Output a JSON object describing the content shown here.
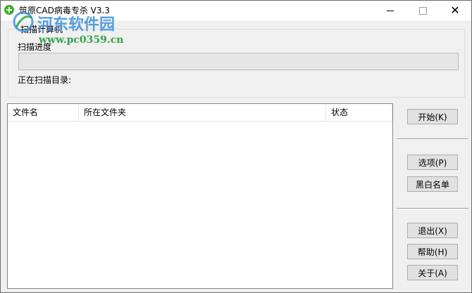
{
  "window": {
    "title": "筑原CAD病毒专杀 V3.3",
    "icon": "plus-circle-icon",
    "controls": {
      "minimize": "minimize-icon",
      "maximize": "maximize-icon",
      "close": "close-icon"
    }
  },
  "watermark": {
    "main": "河东软件园",
    "url": "www.pc0359.cn"
  },
  "scan_group": {
    "label": "扫描计算机",
    "progress_label": "扫描进度",
    "progress_value": 0,
    "dir_label": "正在扫描目录:"
  },
  "results": {
    "columns": [
      "文件名",
      "所在文件夹",
      "状态"
    ],
    "rows": []
  },
  "buttons": {
    "start": "开始(K)",
    "options": "选项(P)",
    "blacklist": "黑白名单",
    "exit": "退出(X)",
    "help": "帮助(H)",
    "about": "关于(A)"
  },
  "colors": {
    "accent": "#3fae2a",
    "progress": "#06b025",
    "watermark_blue": "#3a8fdc",
    "watermark_green": "#1e9b3c"
  }
}
